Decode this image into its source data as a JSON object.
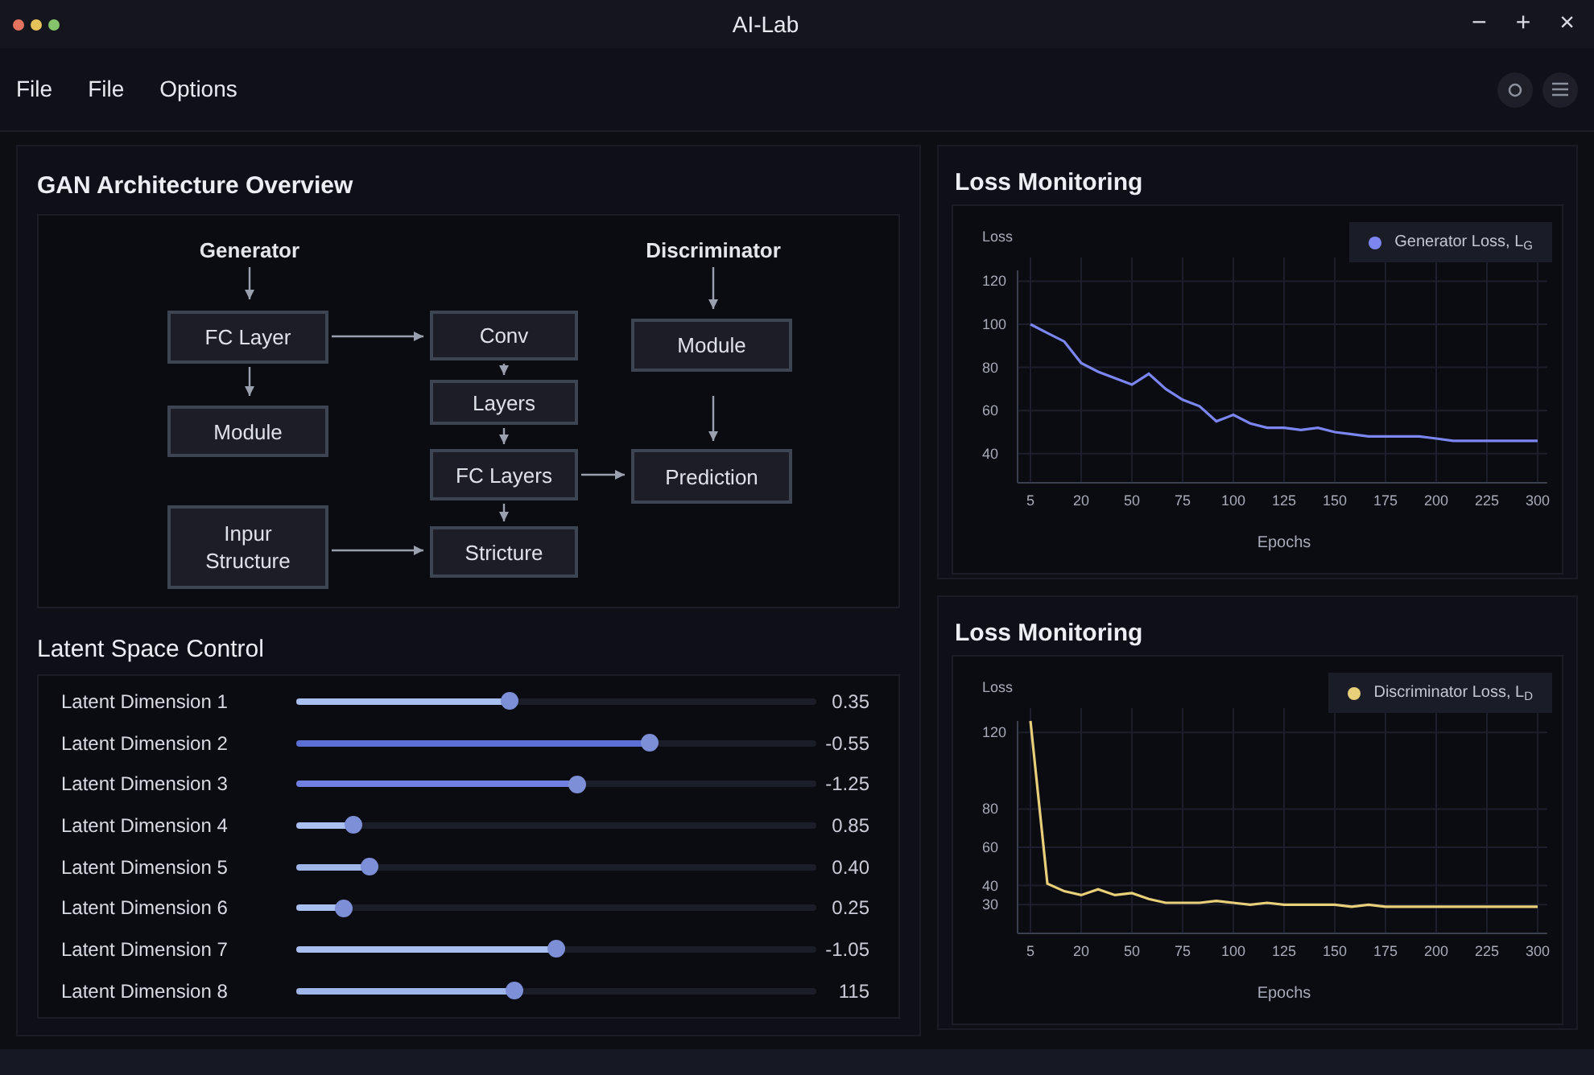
{
  "window": {
    "title": "AI-Lab",
    "controls": [
      "−",
      "+",
      "×"
    ]
  },
  "menu": [
    "File",
    "File",
    "Options"
  ],
  "architecture": {
    "title": "GAN Architecture Overview",
    "headers": [
      "Generator",
      "Discriminator"
    ],
    "nodes": [
      {
        "label": "FC Layer"
      },
      {
        "label": "Module"
      },
      {
        "label": "Inpur Structure"
      },
      {
        "label": "Conv"
      },
      {
        "label": "Layers"
      },
      {
        "label": "FC Layers"
      },
      {
        "label": "Stricture"
      },
      {
        "label": "Module"
      },
      {
        "label": "Prediction"
      }
    ]
  },
  "latent": {
    "title": "Latent Space Control",
    "sliders": [
      {
        "label": "Latent Dimension 1",
        "level": 0.41,
        "color": "#a9bff0",
        "reading": "0.35"
      },
      {
        "label": "Latent Dimension 2",
        "level": 0.68,
        "color": "#5b6fd6",
        "reading": "-0.55"
      },
      {
        "label": "Latent Dimension 3",
        "level": 0.54,
        "color": "#7080e2",
        "reading": "-1.25"
      },
      {
        "label": "Latent Dimension 4",
        "level": 0.11,
        "color": "#a9bff0",
        "reading": "0.85"
      },
      {
        "label": "Latent Dimension 5",
        "level": 0.14,
        "color": "#9fb6e8",
        "reading": "0.40"
      },
      {
        "label": "Latent Dimension 6",
        "level": 0.09,
        "color": "#a9bff0",
        "reading": "0.25"
      },
      {
        "label": "Latent Dimension 7",
        "level": 0.5,
        "color": "#a9bff0",
        "reading": "-1.05"
      },
      {
        "label": "Latent Dimension 8",
        "level": 0.42,
        "color": "#9fb6e8",
        "reading": "115"
      }
    ]
  },
  "monitors": [
    {
      "title": "Loss Monitoring",
      "chart_data": {
        "type": "line",
        "xlabel": "Epochs",
        "ylabel": "Loss",
        "categories": [
          "5",
          null,
          null,
          "20",
          null,
          null,
          "50",
          null,
          null,
          "75",
          null,
          null,
          "100",
          null,
          null,
          "125",
          null,
          null,
          "150",
          null,
          null,
          "175",
          null,
          null,
          "200",
          null,
          null,
          "225",
          null,
          null,
          "300"
        ],
        "series": [
          {
            "name": "Generator Loss, L$_{G}$",
            "color": "#7b86f0",
            "values": [
              100,
              96,
              92,
              82,
              78,
              75,
              72,
              77,
              70,
              65,
              62,
              55,
              58,
              54,
              52,
              52,
              51,
              52,
              50,
              49,
              48,
              48,
              48,
              48,
              47,
              46,
              46,
              46,
              46,
              46,
              46
            ]
          }
        ],
        "ylim": [
          26.5,
          125
        ],
        "yticks": [
          120,
          100,
          80,
          60,
          40
        ],
        "grid": true
      }
    },
    {
      "title": "Loss Monitoring",
      "chart_data": {
        "type": "line",
        "xlabel": "Epochs",
        "ylabel": "Loss",
        "categories": [
          "5",
          null,
          null,
          "20",
          null,
          null,
          "50",
          null,
          null,
          "75",
          null,
          null,
          "100",
          null,
          null,
          "125",
          null,
          null,
          "150",
          null,
          null,
          "175",
          null,
          null,
          "200",
          null,
          null,
          "225",
          null,
          null,
          "300"
        ],
        "series": [
          {
            "name": "Discriminator Loss, L$_{D}$",
            "color": "#e8cf7a",
            "values": [
              126,
              41,
              37,
              35,
              38,
              35,
              36,
              33,
              31,
              31,
              31,
              32,
              31,
              30,
              31,
              30,
              30,
              30,
              30,
              29,
              30,
              29,
              29,
              29,
              29,
              29,
              29,
              29,
              29,
              29,
              29
            ]
          }
        ],
        "ylim": [
          15,
          126
        ],
        "yticks": [
          120,
          80,
          60,
          40,
          30
        ],
        "grid": true
      }
    }
  ]
}
